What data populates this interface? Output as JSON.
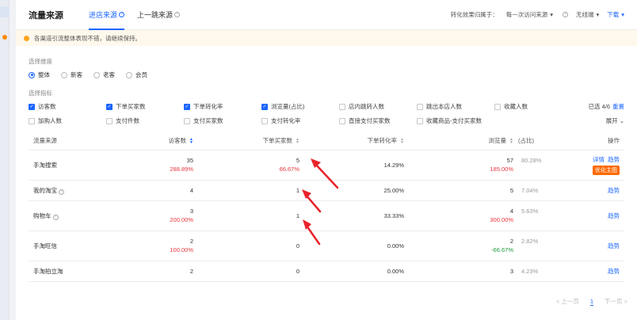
{
  "header": {
    "title": "流量来源",
    "tabs": [
      {
        "label": "进店来源",
        "active": true
      },
      {
        "label": "上一跳来源",
        "active": false
      }
    ],
    "attribution_label": "转化效果归属于：",
    "attribution_value": "每一次访问来源",
    "device_value": "无线端",
    "download_label": "下载"
  },
  "notice": "各渠道引流整体表现不错，请继续保持。",
  "dimension": {
    "label": "选择维度",
    "options": [
      {
        "label": "整体",
        "selected": true
      },
      {
        "label": "新客",
        "selected": false
      },
      {
        "label": "老客",
        "selected": false
      },
      {
        "label": "会员",
        "selected": false
      }
    ]
  },
  "metrics": {
    "label": "选择指标",
    "selected_count": "已选 4/6",
    "reset_label": "重置",
    "expand_label": "展开",
    "options": [
      {
        "label": "访客数",
        "checked": true
      },
      {
        "label": "下单买家数",
        "checked": true
      },
      {
        "label": "下单转化率",
        "checked": true
      },
      {
        "label": "浏览量(占比)",
        "checked": true
      },
      {
        "label": "店内跳转人数",
        "checked": false
      },
      {
        "label": "跳出本店人数",
        "checked": false
      },
      {
        "label": "收藏人数",
        "checked": false
      },
      {
        "label": "加购人数",
        "checked": false
      },
      {
        "label": "支付件数",
        "checked": false
      },
      {
        "label": "支付买家数",
        "checked": false
      },
      {
        "label": "支付转化率",
        "checked": false
      },
      {
        "label": "直接支付买家数",
        "checked": false
      },
      {
        "label": "收藏商品-支付买家数",
        "checked": false
      }
    ]
  },
  "table": {
    "columns": [
      "流量来源",
      "访客数",
      "下单买家数",
      "下单转化率",
      "浏览量",
      "(占比)",
      "操作"
    ],
    "rows": [
      {
        "source": "手淘搜索",
        "visitors": "35",
        "visitors_change": "288.89%",
        "buyers": "5",
        "buyers_change": "66.67%",
        "conv": "14.29%",
        "pv": "57",
        "pv_change": "185.00%",
        "share": "80.28%",
        "ops": [
          "详情",
          "趋势"
        ],
        "badge": "优化主图"
      },
      {
        "source": "我的淘宝",
        "visitors": "4",
        "visitors_change": "",
        "buyers": "1",
        "buyers_change": "",
        "conv": "25.00%",
        "pv": "5",
        "pv_change": "",
        "share": "7.04%",
        "ops": [
          "趋势"
        ],
        "badge": ""
      },
      {
        "source": "购物车",
        "visitors": "3",
        "visitors_change": "200.00%",
        "buyers": "1",
        "buyers_change": "",
        "conv": "33.33%",
        "pv": "4",
        "pv_change": "300.00%",
        "share": "5.63%",
        "ops": [
          "趋势"
        ],
        "badge": ""
      },
      {
        "source": "手淘旺信",
        "visitors": "2",
        "visitors_change": "100.00%",
        "buyers": "0",
        "buyers_change": "",
        "conv": "0.00%",
        "pv": "2",
        "pv_change": "-66.67%",
        "share": "2.82%",
        "ops": [
          "趋势"
        ],
        "badge": ""
      },
      {
        "source": "手淘拍立淘",
        "visitors": "2",
        "visitors_change": "",
        "buyers": "0",
        "buyers_change": "",
        "conv": "0.00%",
        "pv": "3",
        "pv_change": "",
        "share": "4.23%",
        "ops": [
          "趋势"
        ],
        "badge": ""
      }
    ]
  },
  "pager": {
    "prev": "上一页",
    "current": "1",
    "next": "下一页"
  },
  "colors": {
    "accent": "#1a66ff",
    "negative": "#e8363c",
    "positive": "#1a9a3a",
    "badge": "#ff6a00",
    "arrow": "#e8232a"
  }
}
